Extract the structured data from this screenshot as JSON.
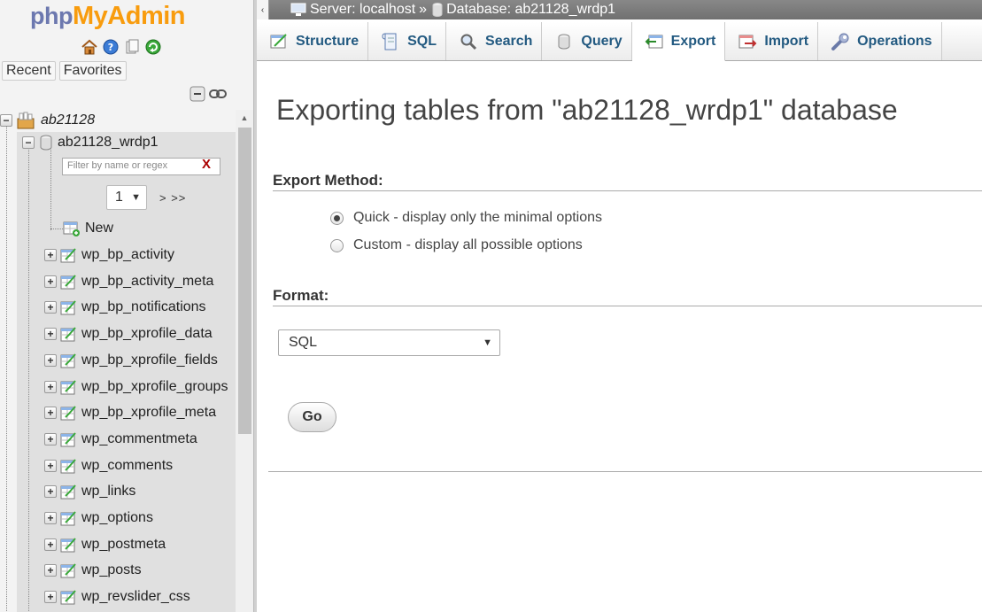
{
  "logo": {
    "php": "php",
    "my": "My",
    "admin": "Admin"
  },
  "nav": {
    "recent_label": "Recent",
    "favorites_label": "Favorites",
    "server_node": "ab21128",
    "database_node": "ab21128_wrdp1",
    "filter_placeholder": "Filter by name or regex",
    "filter_clear": "X",
    "pager_value": "1",
    "pager_next": "> >>",
    "new_label": "New",
    "tables": [
      "wp_bp_activity",
      "wp_bp_activity_meta",
      "wp_bp_notifications",
      "wp_bp_xprofile_data",
      "wp_bp_xprofile_fields",
      "wp_bp_xprofile_groups",
      "wp_bp_xprofile_meta",
      "wp_commentmeta",
      "wp_comments",
      "wp_links",
      "wp_options",
      "wp_postmeta",
      "wp_posts",
      "wp_revslider_css"
    ]
  },
  "breadcrumb": {
    "server": "Server: localhost",
    "separator": "»",
    "database": "Database: ab21128_wrdp1"
  },
  "tabs": [
    {
      "label": "Structure",
      "icon": "structure-icon"
    },
    {
      "label": "SQL",
      "icon": "sql-icon"
    },
    {
      "label": "Search",
      "icon": "search-icon"
    },
    {
      "label": "Query",
      "icon": "query-icon"
    },
    {
      "label": "Export",
      "icon": "export-icon",
      "active": true
    },
    {
      "label": "Import",
      "icon": "import-icon"
    },
    {
      "label": "Operations",
      "icon": "wrench-icon"
    }
  ],
  "main": {
    "title": "Exporting tables from \"ab21128_wrdp1\" database",
    "export_method_heading": "Export Method:",
    "method_quick": "Quick - display only the minimal options",
    "method_custom": "Custom - display all possible options",
    "format_heading": "Format:",
    "format_value": "SQL",
    "go_label": "Go"
  },
  "colors": {
    "tab_text": "#235a81",
    "logo_php": "#6c78af",
    "logo_myadmin": "#f89c0e"
  }
}
